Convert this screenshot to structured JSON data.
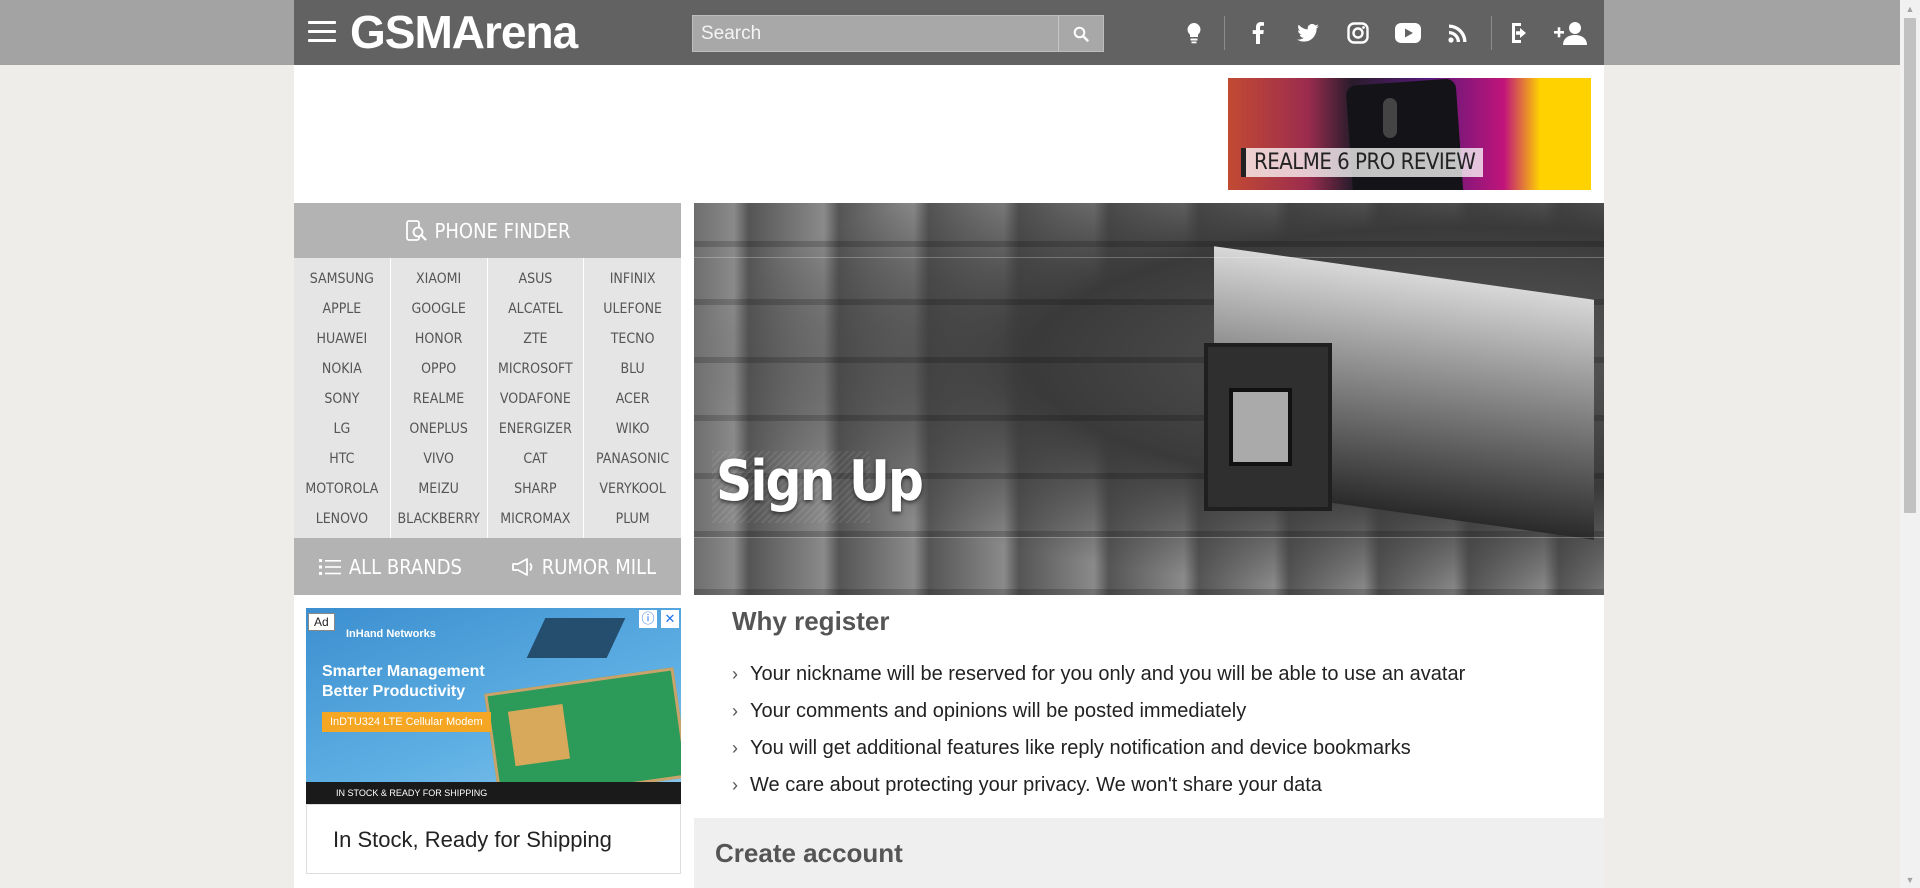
{
  "header": {
    "logo": "GSMArena",
    "search_placeholder": "Search",
    "icons": [
      "menu-icon",
      "search-icon",
      "tip-icon",
      "facebook-icon",
      "twitter-icon",
      "instagram-icon",
      "youtube-icon",
      "rss-icon",
      "login-icon",
      "signup-icon"
    ]
  },
  "promo": {
    "label": "REALME 6 PRO REVIEW"
  },
  "phone_finder": {
    "title": "PHONE FINDER",
    "brand_columns": [
      [
        "SAMSUNG",
        "APPLE",
        "HUAWEI",
        "NOKIA",
        "SONY",
        "LG",
        "HTC",
        "MOTOROLA",
        "LENOVO"
      ],
      [
        "XIAOMI",
        "GOOGLE",
        "HONOR",
        "OPPO",
        "REALME",
        "ONEPLUS",
        "VIVO",
        "MEIZU",
        "BLACKBERRY"
      ],
      [
        "ASUS",
        "ALCATEL",
        "ZTE",
        "MICROSOFT",
        "VODAFONE",
        "ENERGIZER",
        "CAT",
        "SHARP",
        "MICROMAX"
      ],
      [
        "INFINIX",
        "ULEFONE",
        "TECNO",
        "BLU",
        "ACER",
        "WIKO",
        "PANASONIC",
        "VERYKOOL",
        "PLUM"
      ]
    ],
    "all_brands": "ALL BRANDS",
    "rumor_mill": "RUMOR MILL"
  },
  "ad": {
    "badge": "Ad",
    "brand": "InHand Networks",
    "headline_1": "Smarter Management",
    "headline_2": "Better Productivity",
    "tag": "InDTU324 LTE Cellular Modem",
    "footer": "IN STOCK & READY FOR SHIPPING",
    "caption": "In Stock, Ready for Shipping"
  },
  "hero": {
    "title": "Sign Up"
  },
  "why_register": {
    "title": "Why register",
    "items": [
      "Your nickname will be reserved for you only and you will be able to use an avatar",
      "Your comments and opinions will be posted immediately",
      "You will get additional features like reply notification and device bookmarks",
      "We care about protecting your privacy. We won't share your data"
    ]
  },
  "create_account": {
    "title": "Create account"
  }
}
